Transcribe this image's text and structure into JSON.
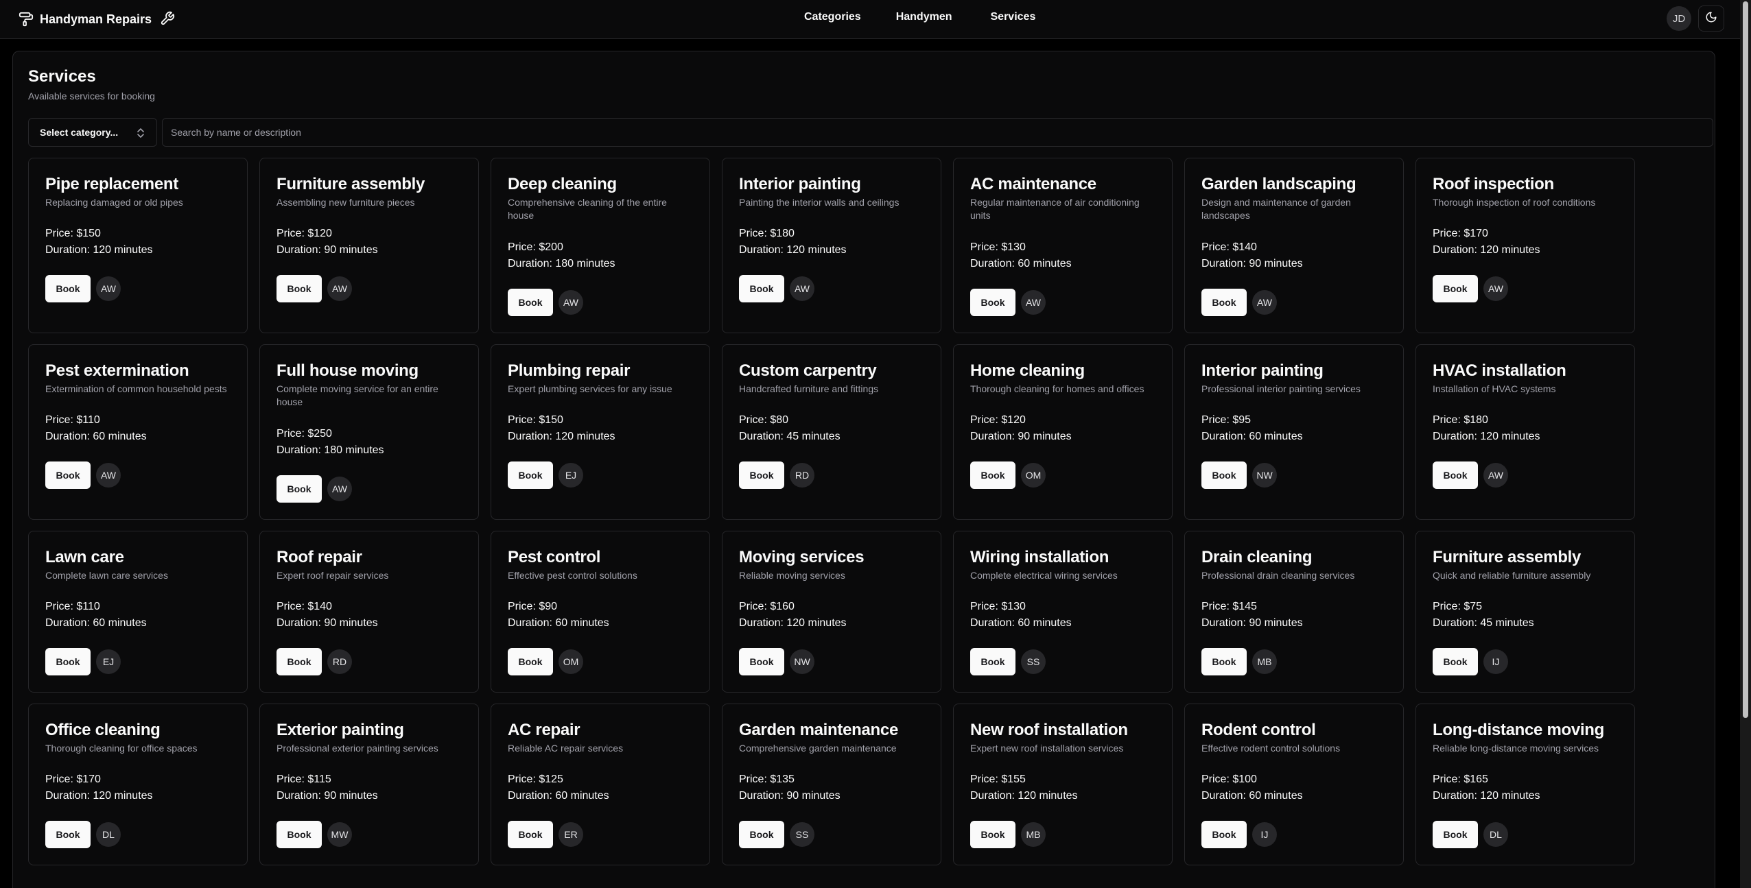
{
  "header": {
    "brand": "Handyman Repairs",
    "nav": [
      "Categories",
      "Handymen",
      "Services"
    ],
    "user_initials": "JD"
  },
  "page": {
    "title": "Services",
    "subtitle": "Available services for booking",
    "category_select": "Select category...",
    "search_placeholder": "Search by name or description"
  },
  "book_label": "Book",
  "services": [
    {
      "title": "Pipe replacement",
      "desc": "Replacing damaged or old pipes",
      "price": "Price: $150",
      "duration": "Duration: 120 minutes",
      "handyman": "AW"
    },
    {
      "title": "Furniture assembly",
      "desc": "Assembling new furniture pieces",
      "price": "Price: $120",
      "duration": "Duration: 90 minutes",
      "handyman": "AW"
    },
    {
      "title": "Deep cleaning",
      "desc": "Comprehensive cleaning of the entire house",
      "price": "Price: $200",
      "duration": "Duration: 180 minutes",
      "handyman": "AW"
    },
    {
      "title": "Interior painting",
      "desc": "Painting the interior walls and ceilings",
      "price": "Price: $180",
      "duration": "Duration: 120 minutes",
      "handyman": "AW"
    },
    {
      "title": "AC maintenance",
      "desc": "Regular maintenance of air conditioning units",
      "price": "Price: $130",
      "duration": "Duration: 60 minutes",
      "handyman": "AW"
    },
    {
      "title": "Garden landscaping",
      "desc": "Design and maintenance of garden landscapes",
      "price": "Price: $140",
      "duration": "Duration: 90 minutes",
      "handyman": "AW"
    },
    {
      "title": "Roof inspection",
      "desc": "Thorough inspection of roof conditions",
      "price": "Price: $170",
      "duration": "Duration: 120 minutes",
      "handyman": "AW"
    },
    {
      "title": "Pest extermination",
      "desc": "Extermination of common household pests",
      "price": "Price: $110",
      "duration": "Duration: 60 minutes",
      "handyman": "AW"
    },
    {
      "title": "Full house moving",
      "desc": "Complete moving service for an entire house",
      "price": "Price: $250",
      "duration": "Duration: 180 minutes",
      "handyman": "AW"
    },
    {
      "title": "Plumbing repair",
      "desc": "Expert plumbing services for any issue",
      "price": "Price: $150",
      "duration": "Duration: 120 minutes",
      "handyman": "EJ"
    },
    {
      "title": "Custom carpentry",
      "desc": "Handcrafted furniture and fittings",
      "price": "Price: $80",
      "duration": "Duration: 45 minutes",
      "handyman": "RD"
    },
    {
      "title": "Home cleaning",
      "desc": "Thorough cleaning for homes and offices",
      "price": "Price: $120",
      "duration": "Duration: 90 minutes",
      "handyman": "OM"
    },
    {
      "title": "Interior painting",
      "desc": "Professional interior painting services",
      "price": "Price: $95",
      "duration": "Duration: 60 minutes",
      "handyman": "NW"
    },
    {
      "title": "HVAC installation",
      "desc": "Installation of HVAC systems",
      "price": "Price: $180",
      "duration": "Duration: 120 minutes",
      "handyman": "AW"
    },
    {
      "title": "Lawn care",
      "desc": "Complete lawn care services",
      "price": "Price: $110",
      "duration": "Duration: 60 minutes",
      "handyman": "EJ"
    },
    {
      "title": "Roof repair",
      "desc": "Expert roof repair services",
      "price": "Price: $140",
      "duration": "Duration: 90 minutes",
      "handyman": "RD"
    },
    {
      "title": "Pest control",
      "desc": "Effective pest control solutions",
      "price": "Price: $90",
      "duration": "Duration: 60 minutes",
      "handyman": "OM"
    },
    {
      "title": "Moving services",
      "desc": "Reliable moving services",
      "price": "Price: $160",
      "duration": "Duration: 120 minutes",
      "handyman": "NW"
    },
    {
      "title": "Wiring installation",
      "desc": "Complete electrical wiring services",
      "price": "Price: $130",
      "duration": "Duration: 60 minutes",
      "handyman": "SS"
    },
    {
      "title": "Drain cleaning",
      "desc": "Professional drain cleaning services",
      "price": "Price: $145",
      "duration": "Duration: 90 minutes",
      "handyman": "MB"
    },
    {
      "title": "Furniture assembly",
      "desc": "Quick and reliable furniture assembly",
      "price": "Price: $75",
      "duration": "Duration: 45 minutes",
      "handyman": "IJ"
    },
    {
      "title": "Office cleaning",
      "desc": "Thorough cleaning for office spaces",
      "price": "Price: $170",
      "duration": "Duration: 120 minutes",
      "handyman": "DL"
    },
    {
      "title": "Exterior painting",
      "desc": "Professional exterior painting services",
      "price": "Price: $115",
      "duration": "Duration: 90 minutes",
      "handyman": "MW"
    },
    {
      "title": "AC repair",
      "desc": "Reliable AC repair services",
      "price": "Price: $125",
      "duration": "Duration: 60 minutes",
      "handyman": "ER"
    },
    {
      "title": "Garden maintenance",
      "desc": "Comprehensive garden maintenance",
      "price": "Price: $135",
      "duration": "Duration: 90 minutes",
      "handyman": "SS"
    },
    {
      "title": "New roof installation",
      "desc": "Expert new roof installation services",
      "price": "Price: $155",
      "duration": "Duration: 120 minutes",
      "handyman": "MB"
    },
    {
      "title": "Rodent control",
      "desc": "Effective rodent control solutions",
      "price": "Price: $100",
      "duration": "Duration: 60 minutes",
      "handyman": "IJ"
    },
    {
      "title": "Long-distance moving",
      "desc": "Reliable long-distance moving services",
      "price": "Price: $165",
      "duration": "Duration: 120 minutes",
      "handyman": "DL"
    }
  ]
}
